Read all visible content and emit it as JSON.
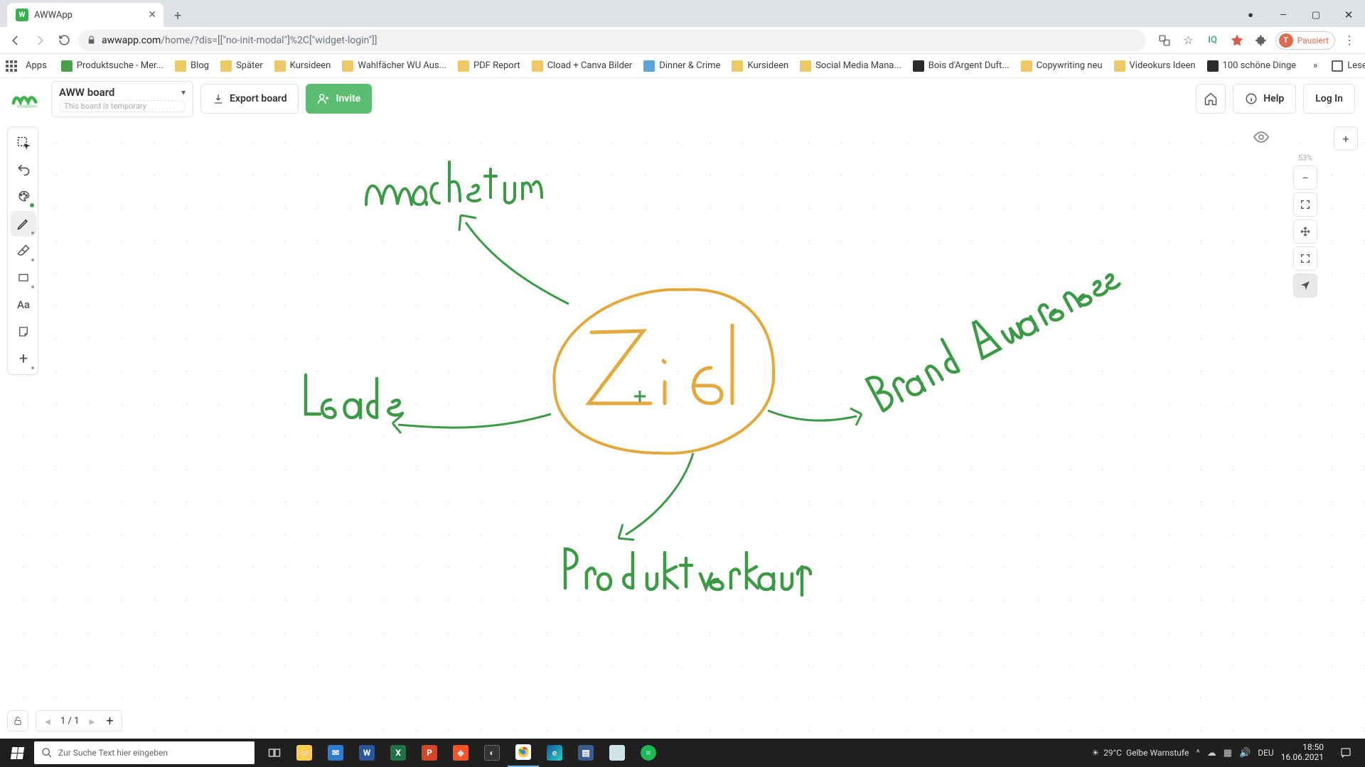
{
  "browser": {
    "tab_title": "AWWApp",
    "url_host": "awwapp.com",
    "url_path": "/home/?dis=[[\"no-init-modal\"]%2C[\"widget-login\"]]",
    "pause_label": "Pausiert",
    "pause_initial": "T",
    "apps_label": "Apps",
    "bookmarks": [
      "Produktsuche - Mer...",
      "Blog",
      "Später",
      "Kursideen",
      "Wahlfächer WU Aus...",
      "PDF Report",
      "Cload + Canva Bilder",
      "Dinner & Crime",
      "Kursideen",
      "Social Media Mana...",
      "Bois d'Argent Duft...",
      "Copywriting neu",
      "Videokurs Ideen",
      "100 schöne Dinge"
    ],
    "bookmark_fav_colors": [
      "#4aa04a",
      "#eec766",
      "#eec766",
      "#eec766",
      "#eec766",
      "#eec766",
      "#eec766",
      "#57a8d8",
      "#eec766",
      "#eec766",
      "#2b2b2b",
      "#eec766",
      "#eec766",
      "#2b2b2b"
    ],
    "reading_list": "Leseliste"
  },
  "app": {
    "board_name": "AWW board",
    "board_temp": "This board is temporary",
    "export_label": "Export board",
    "invite_label": "Invite",
    "help_label": "Help",
    "login_label": "Log In",
    "zoom_pct": "53%",
    "page_current": "1",
    "page_total": "1",
    "text_tool": "Aa"
  },
  "drawing": {
    "center_word": "Ziel",
    "top_word": "Wachstum",
    "left_word": "Leads",
    "right_word": "Brand Awareness",
    "bottom_word": "Produktverkauf",
    "green": "#3c9a46",
    "orange": "#e3a93c"
  },
  "taskbar": {
    "search_placeholder": "Zur Suche Text hier eingeben",
    "temp": "29°C",
    "weather": "Gelbe Warnstufe",
    "lang": "DEU",
    "time": "18:50",
    "date": "16.06.2021"
  }
}
